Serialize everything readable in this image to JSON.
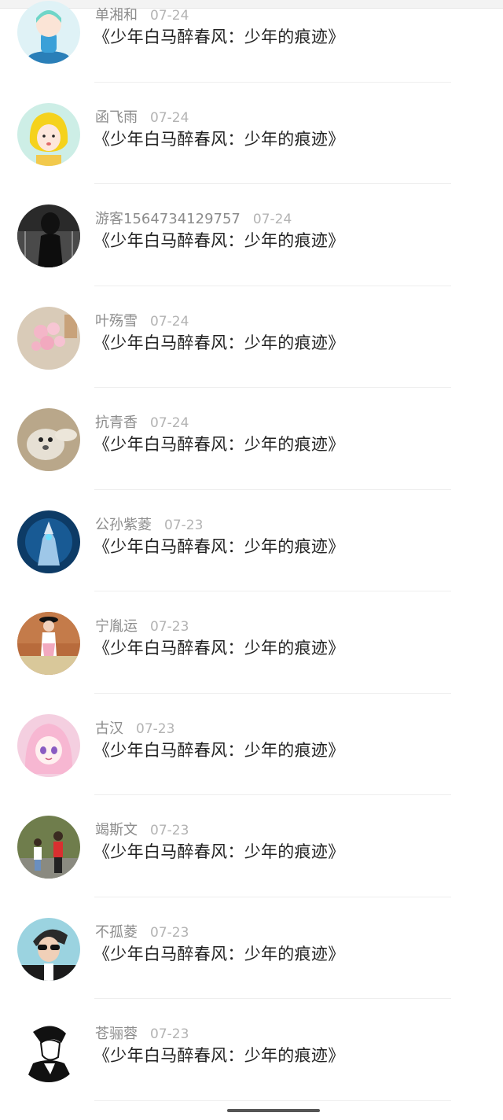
{
  "comments": [
    {
      "name": "单湘和",
      "date": "07-24",
      "title": "《少年白马醉春风：少年的痕迹》",
      "avatar_icon": "anime-chibi-avatar-icon",
      "avatar_bg": "#dff2f6"
    },
    {
      "name": "函飞雨",
      "date": "07-24",
      "title": "《少年白马醉春风：少年的痕迹》",
      "avatar_icon": "yellow-hair-girl-avatar-icon",
      "avatar_bg": "#cdeee6"
    },
    {
      "name": "游客1564734129757",
      "date": "07-24",
      "title": "《少年白马醉春风：少年的痕迹》",
      "avatar_icon": "dark-photo-avatar-icon",
      "avatar_bg": "#2a2a2a"
    },
    {
      "name": "叶殇雪",
      "date": "07-24",
      "title": "《少年白马醉春风：少年的痕迹》",
      "avatar_icon": "pink-flowers-avatar-icon",
      "avatar_bg": "#d9cbb8"
    },
    {
      "name": "抗青香",
      "date": "07-24",
      "title": "《少年白马醉春风：少年的痕迹》",
      "avatar_icon": "seal-avatar-icon",
      "avatar_bg": "#b9a78a"
    },
    {
      "name": "公孙紫菱",
      "date": "07-23",
      "title": "《少年白马醉春风：少年的痕迹》",
      "avatar_icon": "armored-knight-avatar-icon",
      "avatar_bg": "#0d3b66"
    },
    {
      "name": "宁胤运",
      "date": "07-23",
      "title": "《少年白马醉春风：少年的痕迹》",
      "avatar_icon": "girl-photo-avatar-icon",
      "avatar_bg": "#b86b3c"
    },
    {
      "name": "古汉",
      "date": "07-23",
      "title": "《少年白马醉春风：少年的痕迹》",
      "avatar_icon": "pink-anime-girl-avatar-icon",
      "avatar_bg": "#f4cfe0"
    },
    {
      "name": "竭斯文",
      "date": "07-23",
      "title": "《少年白马醉春风：少年的痕迹》",
      "avatar_icon": "kids-photo-avatar-icon",
      "avatar_bg": "#6f7d4c"
    },
    {
      "name": "不孤菱",
      "date": "07-23",
      "title": "《少年白马醉春风：少年的痕迹》",
      "avatar_icon": "sunglasses-man-avatar-icon",
      "avatar_bg": "#9bd3e0"
    },
    {
      "name": "苍骊蓉",
      "date": "07-23",
      "title": "《少年白马醉春风：少年的痕迹》",
      "avatar_icon": "ink-sketch-avatar-icon",
      "avatar_bg": "#ffffff"
    }
  ]
}
